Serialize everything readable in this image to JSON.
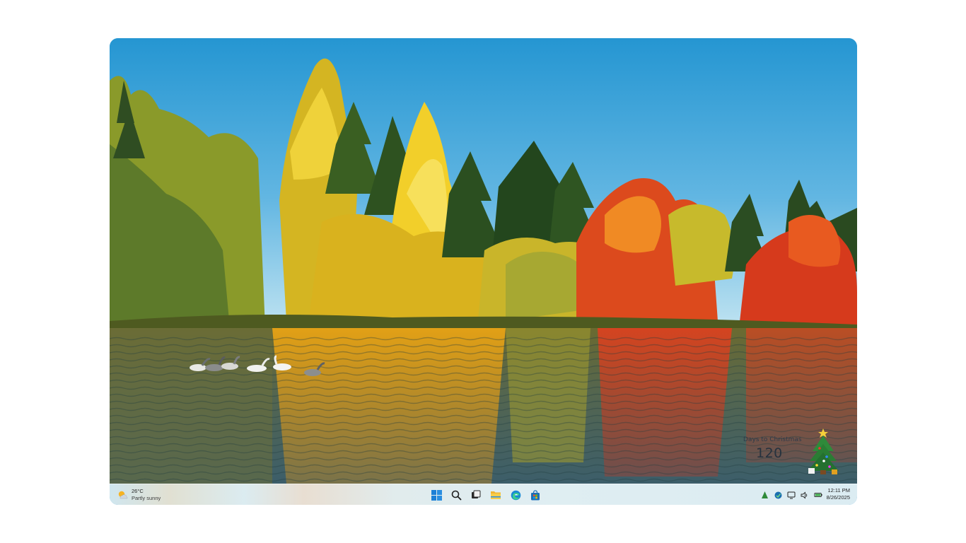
{
  "desktop": {
    "wallpaper": "autumn-lake-with-geese",
    "colors": {
      "sky_top": "#2f9ad4",
      "sky_bottom": "#a9d7ec",
      "water": "#4a6a62",
      "foliage_yellow": "#e8c21e",
      "foliage_red": "#d8381c"
    }
  },
  "widget": {
    "label": "Days to Christmas",
    "count": "120",
    "icon": "christmas-tree-icon"
  },
  "taskbar": {
    "weather": {
      "temp": "26°C",
      "condition": "Partly sunny",
      "icon": "partly-sunny-icon"
    },
    "apps": [
      {
        "name": "start",
        "icon": "windows-logo-icon"
      },
      {
        "name": "search",
        "icon": "search-icon"
      },
      {
        "name": "task-view",
        "icon": "task-view-icon"
      },
      {
        "name": "file-explorer",
        "icon": "folder-icon"
      },
      {
        "name": "edge",
        "icon": "edge-browser-icon"
      },
      {
        "name": "store",
        "icon": "store-icon"
      }
    ],
    "tray": {
      "icons": [
        "christmas-tree-tray-icon",
        "defender-icon",
        "network-icon",
        "volume-icon",
        "battery-icon"
      ]
    },
    "clock": {
      "time": "12:11 PM",
      "date": "8/26/2025"
    }
  }
}
